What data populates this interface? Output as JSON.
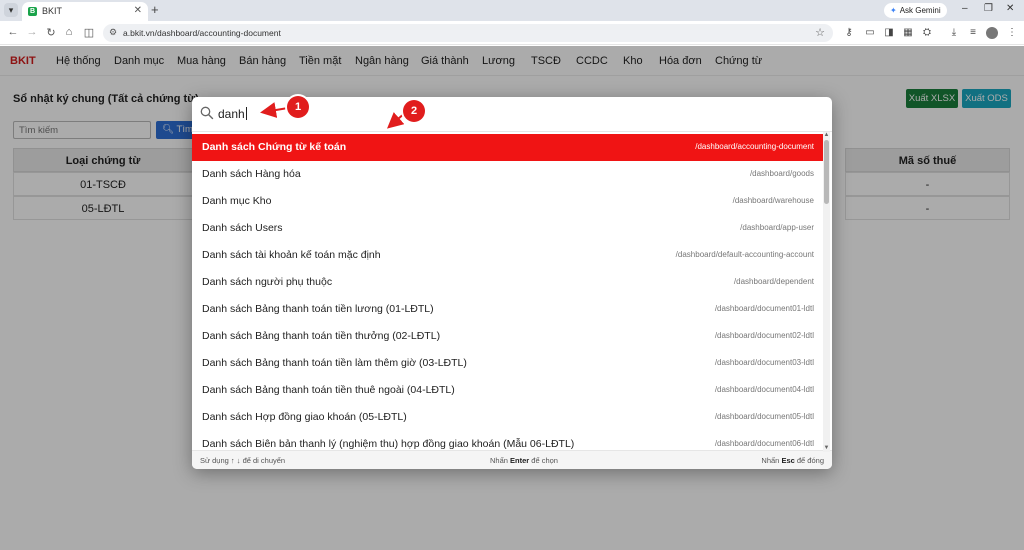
{
  "browser": {
    "tab_title": "BKIT",
    "tab_favicon": "B",
    "url": "a.bkit.vn/dashboard/accounting-document",
    "gemini_label": "Ask Gemini"
  },
  "app": {
    "brand": "BKIT",
    "nav": [
      "Hệ thống",
      "Danh mục",
      "Mua hàng",
      "Bán hàng",
      "Tiền mặt",
      "Ngân hàng",
      "Giá thành",
      "Lương",
      "TSCĐ",
      "CCDC",
      "Kho",
      "Hóa đơn",
      "Chứng từ"
    ]
  },
  "page": {
    "title": "Sổ nhật ký chung (Tất cả chứng từ)",
    "export_xlsx": "Xuất XLSX",
    "export_ods": "Xuất ODS",
    "search_placeholder": "Tìm kiếm",
    "search_button": "Tìm",
    "table": {
      "headers": [
        "Loại chứng từ",
        "Mã số thuế"
      ],
      "rows": [
        {
          "type": "01-TSCĐ",
          "tax": "-"
        },
        {
          "type": "05-LĐTL",
          "tax": "-"
        }
      ]
    }
  },
  "palette": {
    "query": "danh",
    "items": [
      {
        "label": "Danh sách Chứng từ kế toán",
        "path": "/dashboard/accounting-document",
        "active": true
      },
      {
        "label": "Danh sách Hàng hóa",
        "path": "/dashboard/goods"
      },
      {
        "label": "Danh mục Kho",
        "path": "/dashboard/warehouse"
      },
      {
        "label": "Danh sách Users",
        "path": "/dashboard/app-user"
      },
      {
        "label": "Danh sách tài khoản kế toán mặc định",
        "path": "/dashboard/default-accounting-account"
      },
      {
        "label": "Danh sách người phụ thuộc",
        "path": "/dashboard/dependent"
      },
      {
        "label": "Danh sách Bảng thanh toán tiền lương (01-LĐTL)",
        "path": "/dashboard/document01-ldtl"
      },
      {
        "label": "Danh sách Bảng thanh toán tiền thưởng (02-LĐTL)",
        "path": "/dashboard/document02-ldtl"
      },
      {
        "label": "Danh sách Bảng thanh toán tiền làm thêm giờ (03-LĐTL)",
        "path": "/dashboard/document03-ldtl"
      },
      {
        "label": "Danh sách Bảng thanh toán tiền thuê ngoài (04-LĐTL)",
        "path": "/dashboard/document04-ldtl"
      },
      {
        "label": "Danh sách Hợp đồng giao khoán (05-LĐTL)",
        "path": "/dashboard/document05-ldtl"
      },
      {
        "label": "Danh sách Biên bản thanh lý (nghiệm thu) hợp đồng giao khoán (Mẫu 06-LĐTL)",
        "path": "/dashboard/document06-ldtl"
      }
    ],
    "footer": {
      "nav_prefix": "Sử dụng ",
      "nav_keys": "↑ ↓",
      "nav_suffix": " để di chuyển",
      "enter_prefix": "Nhấn ",
      "enter_key": "Enter",
      "enter_suffix": " để chọn",
      "esc_prefix": "Nhấn ",
      "esc_key": "Esc",
      "esc_suffix": " để đóng"
    }
  },
  "annotations": {
    "badge1": "1",
    "badge2": "2",
    "color": "#e11d1d"
  }
}
